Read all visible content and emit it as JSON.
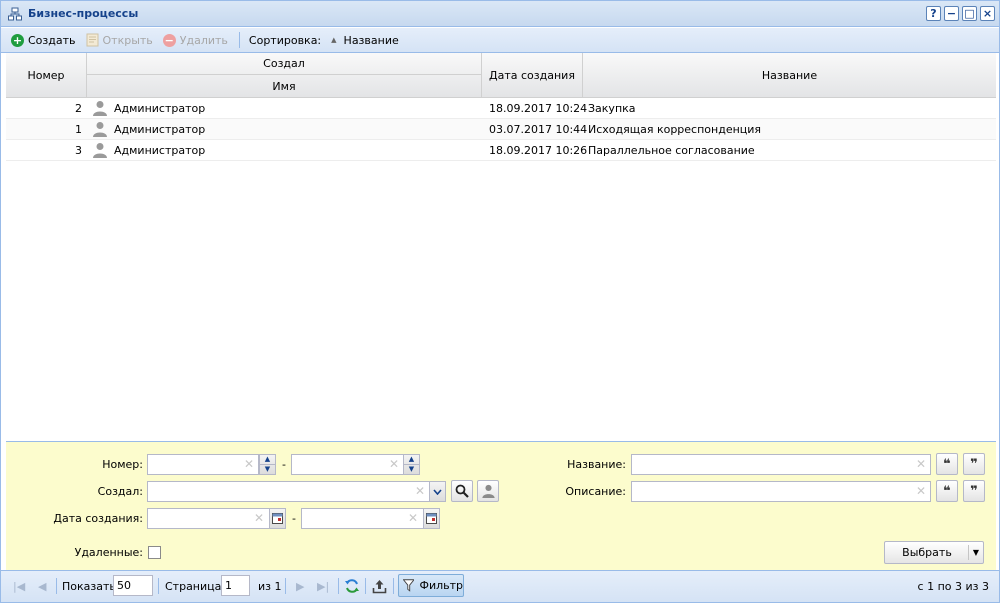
{
  "window": {
    "title": "Бизнес-процессы",
    "buttons": [
      "?",
      "−",
      "□",
      "×"
    ]
  },
  "toolbar": {
    "create_label": "Создать",
    "open_label": "Открыть",
    "delete_label": "Удалить",
    "sort_label": "Сортировка:",
    "sort_field": "Название"
  },
  "grid": {
    "columns": {
      "number": "Номер",
      "created_by": "Создал",
      "created_by_name": "Имя",
      "created_date": "Дата создания",
      "name": "Название"
    },
    "rows": [
      {
        "number": "2",
        "creator": "Администратор",
        "date": "18.09.2017 10:24",
        "name": "Закупка"
      },
      {
        "number": "1",
        "creator": "Администратор",
        "date": "03.07.2017 10:44",
        "name": "Исходящая корреспонденция"
      },
      {
        "number": "3",
        "creator": "Администратор",
        "date": "18.09.2017 10:26",
        "name": "Параллельное согласование"
      }
    ]
  },
  "filter": {
    "number_label": "Номер:",
    "created_by_label": "Создал:",
    "created_date_label": "Дата создания:",
    "deleted_label": "Удаленные:",
    "name_label": "Название:",
    "description_label": "Описание:",
    "range_dash": "-",
    "select_label": "Выбрать",
    "number_from": "",
    "number_to": "",
    "creator": "",
    "date_from": "",
    "date_to": "",
    "name": "",
    "description": ""
  },
  "paging": {
    "show_label": "Показать",
    "page_size": "50",
    "page_label": "Страница",
    "page": "1",
    "of_label": "из 1",
    "filter_label": "Фильтр",
    "summary": "с 1 по 3 из 3"
  },
  "colors": {
    "accent": "#15428b",
    "filter_bg": "#fcfccd",
    "create_icon": "#1f9d3f",
    "delete_icon": "#e35d5d"
  }
}
